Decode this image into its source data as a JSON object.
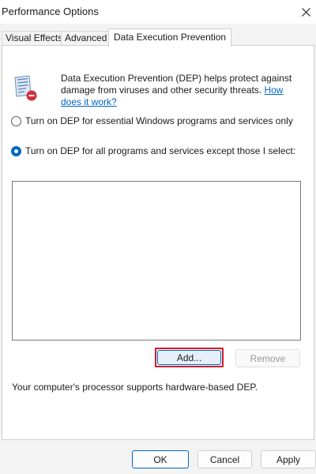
{
  "window": {
    "title": "Performance Options"
  },
  "tabs": [
    {
      "label": "Visual Effects"
    },
    {
      "label": "Advanced"
    },
    {
      "label": "Data Execution Prevention",
      "active": true
    }
  ],
  "dep": {
    "description": "Data Execution Prevention (DEP) helps protect against damage from viruses and other security threats.",
    "link": "How does it work?",
    "option_essential": "Turn on DEP for essential Windows programs and services only",
    "option_all": "Turn on DEP for all programs and services except those I select:",
    "selected_option": "all",
    "programs": [],
    "add_label": "Add...",
    "remove_label": "Remove",
    "support_text": "Your computer's processor supports hardware-based DEP."
  },
  "footer": {
    "ok_label": "OK",
    "cancel_label": "Cancel",
    "apply_label": "Apply"
  },
  "colors": {
    "accent": "#0067c0",
    "highlight_border": "#d11c2c",
    "link": "#0066cc"
  },
  "icons": {
    "dep_icon": "shield-document-icon",
    "close_icon": "close-icon"
  }
}
